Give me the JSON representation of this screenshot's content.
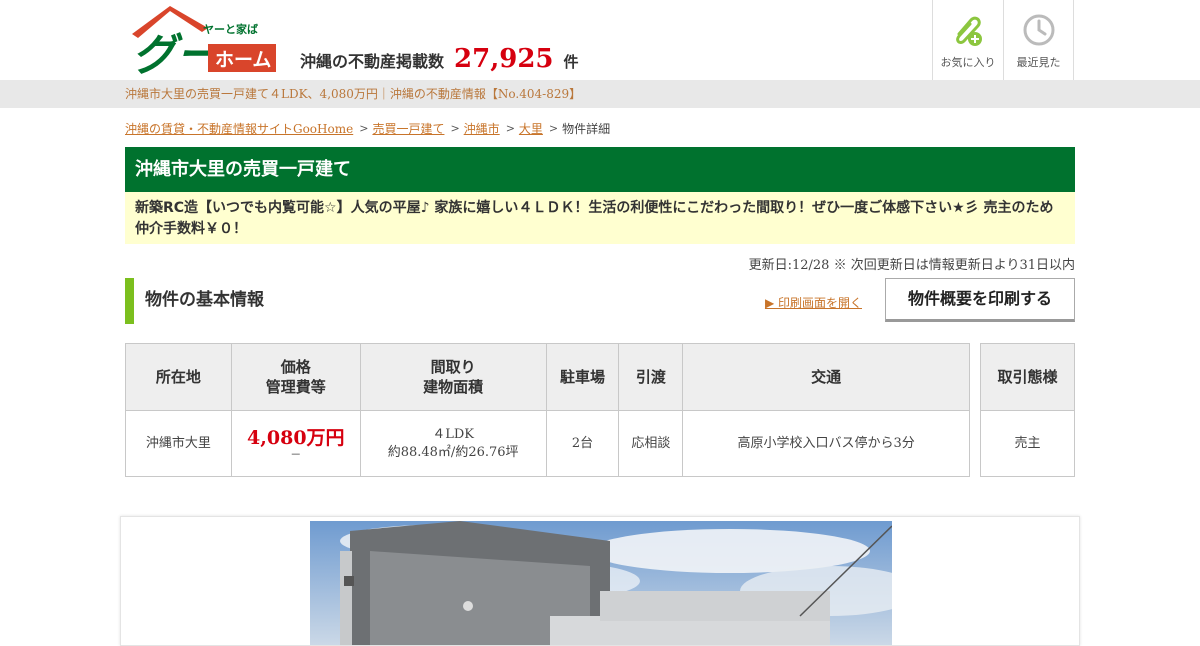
{
  "header": {
    "logo_text": "ヤーと家ばグーホーム",
    "listings_label": "沖縄の不動産掲載数",
    "listings_count": "27,925",
    "listings_unit": "件",
    "favorites_label": "お気に入り",
    "recent_label": "最近見た",
    "colors": {
      "brand_green": "#00722e",
      "brand_red": "#d6000f",
      "accent_lime": "#7bbf1e"
    }
  },
  "page_title": "沖縄市大里の売買一戸建て４LDK、4,080万円｜沖縄の不動産情報【No.404-829】",
  "breadcrumb": [
    {
      "label": "沖縄の賃貸・不動産情報サイトGooHome"
    },
    {
      "label": "売買一戸建て"
    },
    {
      "label": "沖縄市"
    },
    {
      "label": "大里"
    }
  ],
  "breadcrumb_current": "物件詳細",
  "property": {
    "title": "沖縄市大里の売買一戸建て",
    "catchcopy": "新築RC造【いつでも内覧可能☆】人気の平屋♪ 家族に嬉しい４ＬＤＫ！生活の利便性にこだわった間取り！ぜひ一度ご体感下さい★彡 売主のため仲介手数料￥０！",
    "updated": "更新日:12/28 ※ 次回更新日は情報更新日より31日以内"
  },
  "basic_info": {
    "heading": "物件の基本情報",
    "print_link": "▶ 印刷画面を開く",
    "print_button": "物件概要を印刷する",
    "headers": {
      "location": "所在地",
      "price_line1": "価格",
      "price_line2": "管理費等",
      "layout_line1": "間取り",
      "layout_line2": "建物面積",
      "parking": "駐車場",
      "delivery": "引渡",
      "transport": "交通",
      "deal_type": "取引態様"
    },
    "row": {
      "location": "沖縄市大里",
      "price": "4,080万円",
      "management": "－",
      "layout": "４LDK",
      "area": "約88.48㎡/約26.76坪",
      "parking": "2台",
      "delivery": "応相談",
      "transport": "高原小学校入口バス停から3分",
      "deal_type": "売主"
    }
  },
  "photo": {
    "description": "house-exterior-photo"
  }
}
